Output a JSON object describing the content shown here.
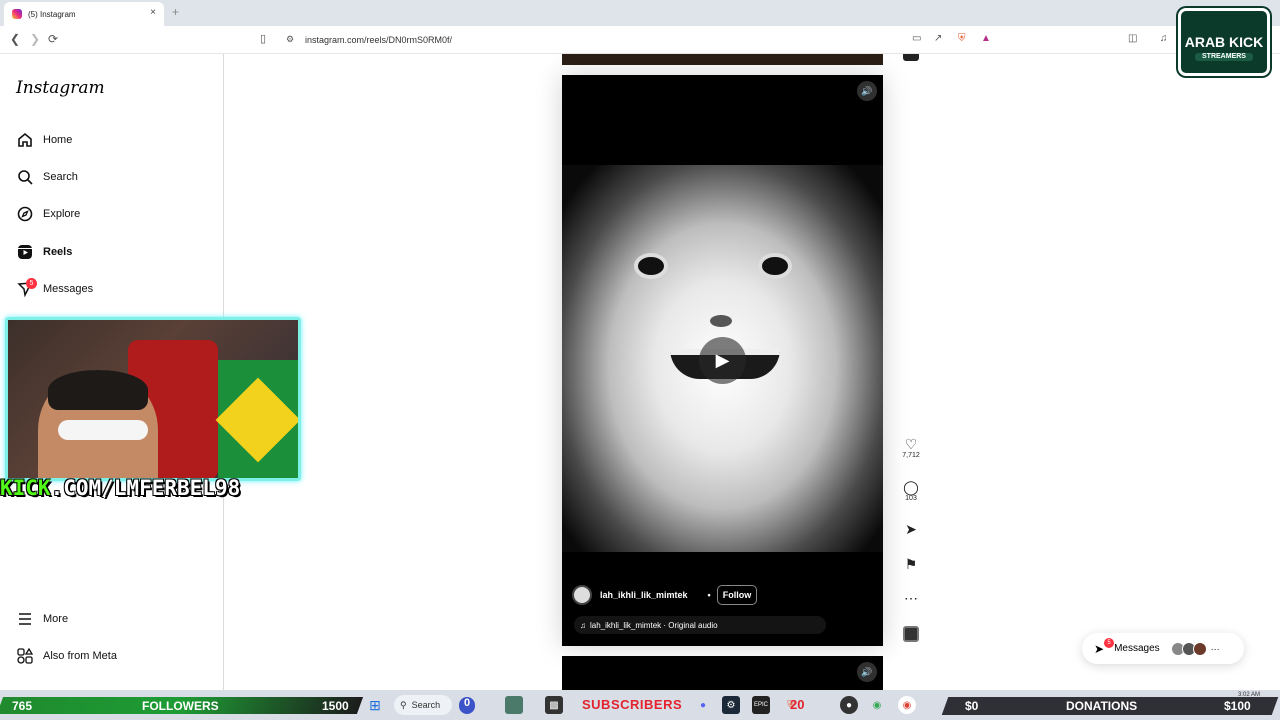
{
  "browser": {
    "tab_title": "(5) Instagram",
    "tab_close": "×",
    "new_tab": "+",
    "url": "instagram.com/reels/DN0rmS0RM0f/"
  },
  "sidebar": {
    "logo": "Instagram",
    "items": [
      {
        "label": "Home",
        "icon": "home-icon"
      },
      {
        "label": "Search",
        "icon": "search-icon"
      },
      {
        "label": "Explore",
        "icon": "compass-icon"
      },
      {
        "label": "Reels",
        "icon": "reels-icon"
      },
      {
        "label": "Messages",
        "icon": "messenger-icon",
        "badge": "5"
      }
    ],
    "bottom_items": [
      {
        "label": "More",
        "icon": "menu-icon"
      },
      {
        "label": "Also from Meta",
        "icon": "meta-icon"
      }
    ]
  },
  "overlay": {
    "kick_prefix": "KICK",
    "kick_url": ".COM/LMFERBEL98",
    "logo_line1": "ARAB KICK",
    "logo_line2": "STREAMERS"
  },
  "reel": {
    "username": "lah_ikhli_lik_mimtek",
    "dot": "•",
    "follow_label": "Follow",
    "audio": "lah_ikhli_lik_mimtek · Original audio",
    "likes": "7,712",
    "comments": "103"
  },
  "messages_pill": {
    "label": "Messages",
    "badge": "5",
    "more": "···"
  },
  "stream_bar": {
    "followers_count": "765",
    "followers_label": "FOLLOWERS",
    "followers_goal": "1500",
    "search_label": "Search",
    "subs_count": "0",
    "subs_label": "SUBSCRIBERS",
    "subs_goal": "20",
    "donations_amount": "$0",
    "donations_label": "DONATIONS",
    "donations_goal": "$100",
    "clock": "3:02 AM",
    "followers_progress": 0.51
  },
  "colors": {
    "kick_green": "#53fc18",
    "badge_red": "#ff3040",
    "subs_red": "#e3232e"
  }
}
